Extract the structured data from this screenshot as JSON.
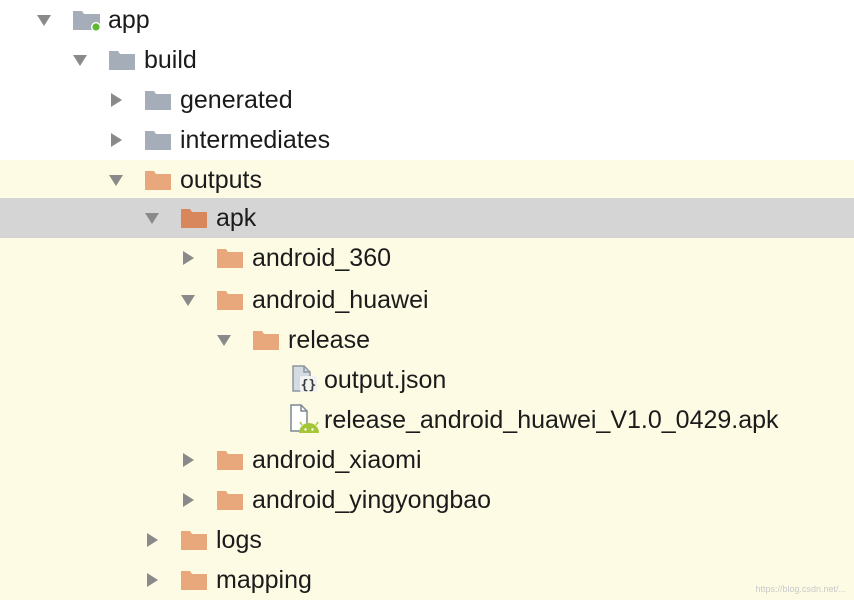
{
  "tree": {
    "items": [
      {
        "label": "app",
        "expanded": true,
        "icon": "module-folder-icon"
      },
      {
        "label": "build",
        "expanded": true,
        "icon": "folder-icon"
      },
      {
        "label": "generated",
        "expanded": false,
        "icon": "folder-icon"
      },
      {
        "label": "intermediates",
        "expanded": false,
        "icon": "folder-icon"
      },
      {
        "label": "outputs",
        "expanded": true,
        "icon": "folder-icon"
      },
      {
        "label": "apk",
        "expanded": true,
        "icon": "folder-icon",
        "selected": true
      },
      {
        "label": "android_360",
        "expanded": false,
        "icon": "folder-icon"
      },
      {
        "label": "android_huawei",
        "expanded": true,
        "icon": "folder-icon"
      },
      {
        "label": "release",
        "expanded": true,
        "icon": "folder-icon"
      },
      {
        "label": "output.json",
        "icon": "json-file-icon"
      },
      {
        "label": "release_android_huawei_V1.0_0429.apk",
        "icon": "apk-file-icon"
      },
      {
        "label": "android_xiaomi",
        "expanded": false,
        "icon": "folder-icon"
      },
      {
        "label": "android_yingyongbao",
        "expanded": false,
        "icon": "folder-icon"
      },
      {
        "label": "logs",
        "expanded": false,
        "icon": "folder-icon"
      },
      {
        "label": "mapping",
        "expanded": false,
        "icon": "folder-icon"
      }
    ]
  },
  "colors": {
    "folder_gray": "#a5aeb8",
    "folder_orange": "#e8a87c",
    "tinted_background": "#fdfbe4",
    "selection": "#d5d5d5",
    "android_green": "#a4c639"
  },
  "watermark": "https://blog.csdn.net/..."
}
